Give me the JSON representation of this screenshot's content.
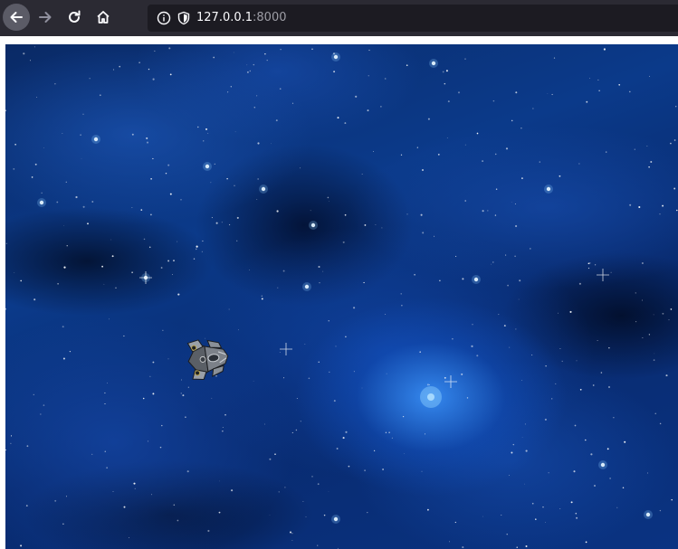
{
  "browser": {
    "url_host": "127.0.0.1",
    "url_port": ":8000",
    "back_icon": "back-arrow-icon",
    "forward_icon": "forward-arrow-icon",
    "reload_icon": "reload-icon",
    "home_icon": "home-icon",
    "info_icon": "info-icon",
    "shield_icon": "shield-icon"
  },
  "game": {
    "background": "starfield-nebula",
    "player_sprite": "spaceship",
    "colors": {
      "nebula_dark": "#082a6e",
      "nebula_bright": "#3c96ff",
      "star": "#ffffff"
    }
  }
}
